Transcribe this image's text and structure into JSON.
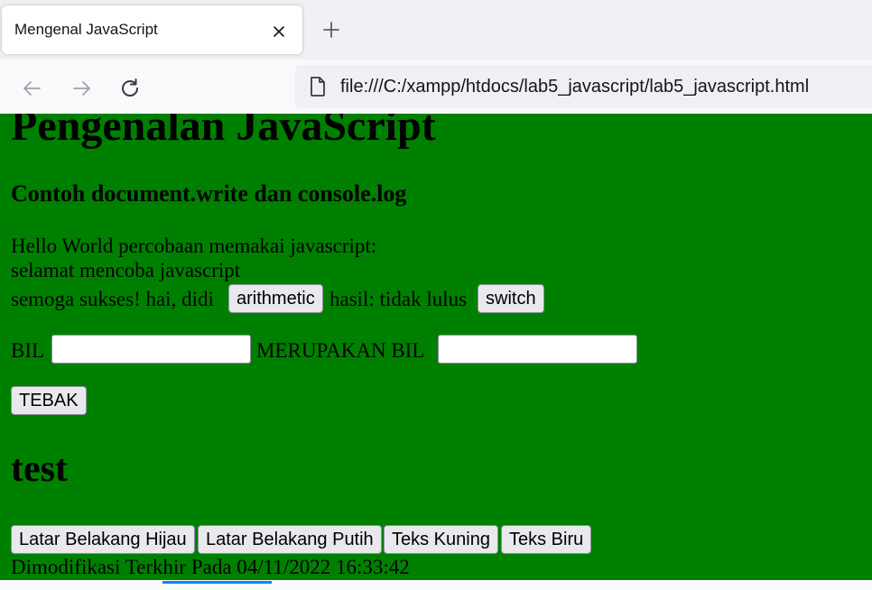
{
  "browser": {
    "tab": {
      "title": "Mengenal JavaScript",
      "close_icon": "close-icon"
    },
    "new_tab_icon": "plus-icon",
    "nav": {
      "back_icon": "arrow-left-icon",
      "forward_icon": "arrow-right-icon",
      "reload_icon": "reload-icon"
    },
    "url": "file:///C:/xampp/htdocs/lab5_javascript/lab5_javascript.html",
    "url_icon": "page-icon"
  },
  "page": {
    "background_color": "#008000",
    "heading": "Pengenalan JavaScript",
    "subheading": "Contoh document.write dan console.log",
    "line1": "Hello World percobaan memakai javascript:",
    "line2": "selamat mencoba javascript",
    "line3_text": "semoga sukses! hai, didi",
    "arithmetic_button": "arithmetic",
    "result_text": "hasil: tidak lulus",
    "switch_button": "switch",
    "bil_label": "BIL",
    "merupakan_label": "MERUPAKAN BIL",
    "bil_input_value": "",
    "merupakan_input_value": "",
    "tebak_button": "TEBAK",
    "section_heading": "test",
    "buttons": {
      "bg_green": "Latar Belakang Hijau",
      "bg_white": "Latar Belakang Putih",
      "text_yellow": "Teks Kuning",
      "text_blue": "Teks Biru"
    },
    "last_modified": "Dimodifikasi Terkhir Pada 04/11/2022 16:33:42"
  }
}
